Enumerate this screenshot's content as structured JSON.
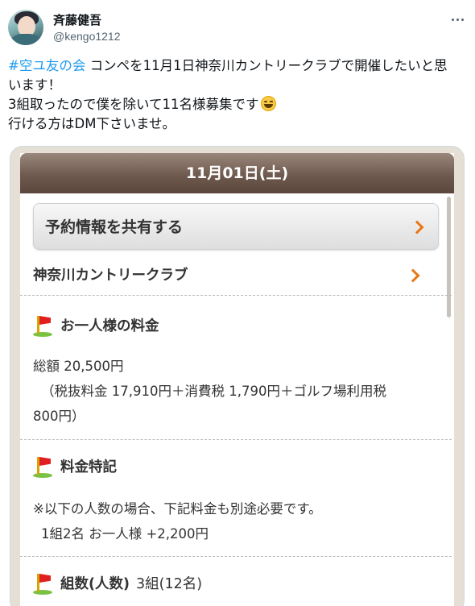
{
  "tweet": {
    "author": {
      "display_name": "斉藤健吾",
      "handle": "@kengo1212"
    },
    "text": {
      "hashtag": "#空ユ友の会",
      "line1_rest": " コンペを11月1日神奈川カントリークラブで開催したいと思",
      "line2": "います！",
      "line3": "3組取ったので僕を除いて11名様募集です",
      "line4": "行ける方はDM下さいませ。",
      "emoji": "grinning-squinting-face"
    }
  },
  "card": {
    "date_header": "11月01日(土)",
    "share_button": "予約情報を共有する",
    "club_name": "神奈川カントリークラブ",
    "fee_section": {
      "title": "お一人様の料金",
      "total": "総額 20,500円",
      "breakdown_line1": "（税抜料金 17,910円＋消費税 1,790円＋ゴルフ場利用税",
      "breakdown_line2": "800円）"
    },
    "special_section": {
      "title": "料金特記",
      "note": "※以下の人数の場合、下記料金も別途必要です。",
      "detail": "1組2名 お一人様 +2,200円"
    },
    "groups_section": {
      "title": "組数(人数)",
      "value": "3組(12名)"
    }
  },
  "colors": {
    "hashtag": "#1d9bf0",
    "date_bar": "#6f5a4f",
    "chevron": "#e97716",
    "flag_red": "#e02020",
    "flag_green": "#7cc242"
  },
  "icons": [
    "more-icon",
    "golf-flag-icon",
    "chevron-right-icon"
  ]
}
